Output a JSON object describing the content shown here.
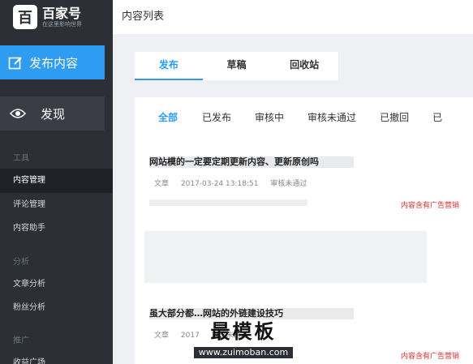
{
  "sidebar": {
    "brand": {
      "logo_char": "百",
      "name": "百家号",
      "slogan": "在这里影响世界"
    },
    "publish_label": "发布内容",
    "discover_label": "发现",
    "sections": {
      "tools": "工具",
      "analysis": "分析",
      "promotion": "推广"
    },
    "items": {
      "content_manage": "内容管理",
      "comment_manage": "评论管理",
      "content_assistant": "内容助手",
      "article_analysis": "文章分析",
      "fans_analysis": "粉丝分析",
      "partial_item": "收益广场"
    }
  },
  "header": {
    "title": "内容列表"
  },
  "tabs": [
    "发布",
    "草稿",
    "回收站"
  ],
  "filters": [
    "全部",
    "已发布",
    "审核中",
    "审核未通过",
    "已撤回",
    "已"
  ],
  "articles": [
    {
      "title": "网站模的一定要定期更新内容、更新原创吗",
      "type": "文章",
      "date": "2017-03-24 13:18:51",
      "status": "审核未通过",
      "warning": "内容含有广告营销"
    },
    {
      "title": "虽大部分都…网站的外链建设技巧",
      "type": "文章",
      "date": "2017",
      "status": "审核未通过",
      "warning": "内容含有广告营销"
    }
  ],
  "watermark": {
    "main": "最模板",
    "url": "www.zuimoban.com"
  },
  "colors": {
    "accent": "#2e9cf0",
    "sidebar_bg": "#2d2f36",
    "warning": "#e0302a"
  }
}
